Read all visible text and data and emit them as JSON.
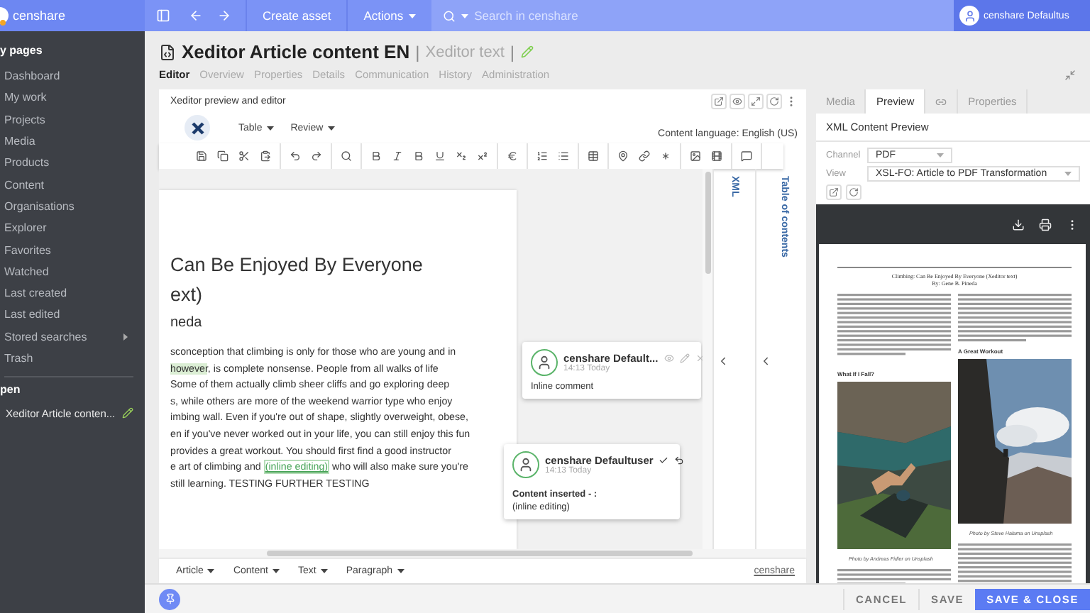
{
  "app": {
    "logo": "censhare"
  },
  "topbar": {
    "create": "Create asset",
    "actions": "Actions",
    "search_placeholder": "Search in censhare",
    "user": "censhare Defaultus"
  },
  "sidebar": {
    "heading": "y pages",
    "items": [
      {
        "label": "Dashboard",
        "has_submenu": false
      },
      {
        "label": "My work",
        "has_submenu": false
      },
      {
        "label": "Projects",
        "has_submenu": false
      },
      {
        "label": "Media",
        "has_submenu": false
      },
      {
        "label": "Products",
        "has_submenu": false
      },
      {
        "label": "Content",
        "has_submenu": false
      },
      {
        "label": "Organisations",
        "has_submenu": false
      },
      {
        "label": "Explorer",
        "has_submenu": false
      },
      {
        "label": "Favorites",
        "has_submenu": false
      },
      {
        "label": "Watched",
        "has_submenu": false
      },
      {
        "label": "Last created",
        "has_submenu": false
      },
      {
        "label": "Last edited",
        "has_submenu": false
      },
      {
        "label": "Stored searches",
        "has_submenu": true
      },
      {
        "label": "Trash",
        "has_submenu": false
      }
    ],
    "open_heading": "pen",
    "open_items": [
      {
        "label": "Xeditor Article conten..."
      }
    ]
  },
  "asset": {
    "title": "Xeditor Article content EN",
    "separator": "|",
    "type": "Xeditor text",
    "tabs": [
      {
        "label": "Editor",
        "selected": true
      },
      {
        "label": "Overview",
        "selected": false
      },
      {
        "label": "Properties",
        "selected": false
      },
      {
        "label": "Details",
        "selected": false
      },
      {
        "label": "Communication",
        "selected": false
      },
      {
        "label": "History",
        "selected": false
      },
      {
        "label": "Administration",
        "selected": false
      }
    ]
  },
  "editor": {
    "title": "Xeditor preview and editor",
    "menus": [
      "Table",
      "Review"
    ],
    "content_language": "Content language: English (US)",
    "doc": {
      "title_lines": [
        "Can Be Enjoyed By Everyone",
        "ext)"
      ],
      "byline": "neda",
      "lines": [
        [
          {
            "text": "sconception that climbing is only for those who are young and in",
            "kind": "plain"
          }
        ],
        [
          {
            "text": "however",
            "kind": "inserted"
          },
          {
            "text": ", is complete nonsense. People from all walks of life",
            "kind": "plain"
          }
        ],
        [
          {
            "text": "Some of them actually climb sheer cliffs and go exploring deep",
            "kind": "plain"
          }
        ],
        [
          {
            "text": "s, while others are more of the weekend warrior type who enjoy",
            "kind": "plain"
          }
        ],
        [
          {
            "text": "imbing wall. Even if you're out of shape, slightly overweight, obese,",
            "kind": "plain"
          }
        ],
        [
          {
            "text": "en if you've never worked out in your life, you can still enjoy this fun",
            "kind": "plain"
          }
        ],
        [
          {
            "text": "provides a great workout. You should first find a good instructor",
            "kind": "plain"
          }
        ],
        [
          {
            "text": "e art of climbing and ",
            "kind": "plain"
          },
          {
            "text": "(inline editing)",
            "kind": "link"
          },
          {
            "text": " who will also make sure you're",
            "kind": "plain"
          }
        ],
        [
          {
            "text": "still learning. TESTING FURTHER TESTING",
            "kind": "plain"
          }
        ]
      ]
    },
    "comments": [
      {
        "kind": "comment",
        "author": "censhare Default...",
        "time": "14:13 Today",
        "body": "Inline comment"
      },
      {
        "kind": "change",
        "author": "censhare Defaultuser",
        "time": "14:13 Today",
        "heading": "Content inserted - :",
        "body": "(inline editing)"
      }
    ],
    "side_tabs": [
      "XML",
      "Table of contents"
    ],
    "bottom_menus": [
      "Article",
      "Content",
      "Text",
      "Paragraph"
    ],
    "brand_link": "censhare"
  },
  "preview": {
    "tabs": [
      {
        "kind": "text",
        "label": "Media",
        "selected": false
      },
      {
        "kind": "text",
        "label": "Preview",
        "selected": true
      },
      {
        "kind": "icon",
        "selected": false
      },
      {
        "kind": "text",
        "label": "Properties",
        "selected": false
      }
    ],
    "heading": "XML Content Preview",
    "channel": {
      "label": "Channel",
      "value": "PDF"
    },
    "view": {
      "label": "View",
      "value": "XSL-FO: Article to PDF Transformation"
    },
    "pdf": {
      "title": "Climbing: Can Be Enjoyed By Everyone (Xeditor text)",
      "byline": "By: Gene B. Pineda",
      "headings": [
        "What If I Fall?",
        "A Great Workout"
      ],
      "captions": [
        "Photo by Andreas Fidler on Unsplash",
        "Photo by Steve Halama on Unsplash"
      ]
    }
  },
  "footer": {
    "buttons": [
      {
        "label": "CANCEL",
        "kind": "plain"
      },
      {
        "label": "SAVE",
        "kind": "plain"
      },
      {
        "label": "SAVE & CLOSE",
        "kind": "primary"
      }
    ]
  }
}
